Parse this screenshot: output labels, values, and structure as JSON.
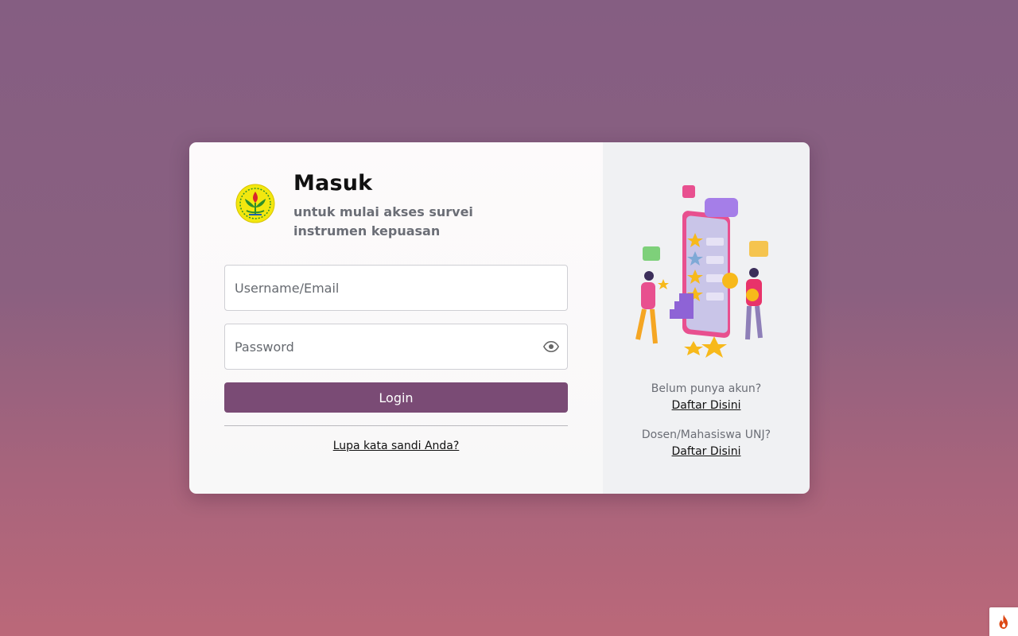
{
  "login_card": {
    "title": "Masuk",
    "subtitle": "untuk mulai akses survei instrumen kepuasan",
    "username_placeholder": "Username/Email",
    "password_placeholder": "Password",
    "login_label": "Login",
    "forgot_label": "Lupa kata sandi Anda?"
  },
  "side_panel": {
    "no_account_text": "Belum punya akun?",
    "register_link": "Daftar Disini",
    "unj_text": "Dosen/Mahasiswa UNJ?",
    "unj_register_link": "Daftar Disini"
  },
  "colors": {
    "accent": "#7a4b75",
    "background_top": "#855e82",
    "background_bottom": "#bb6879"
  },
  "icons": {
    "logo": "university-logo",
    "password_toggle": "eye-icon",
    "corner": "flame-icon"
  }
}
